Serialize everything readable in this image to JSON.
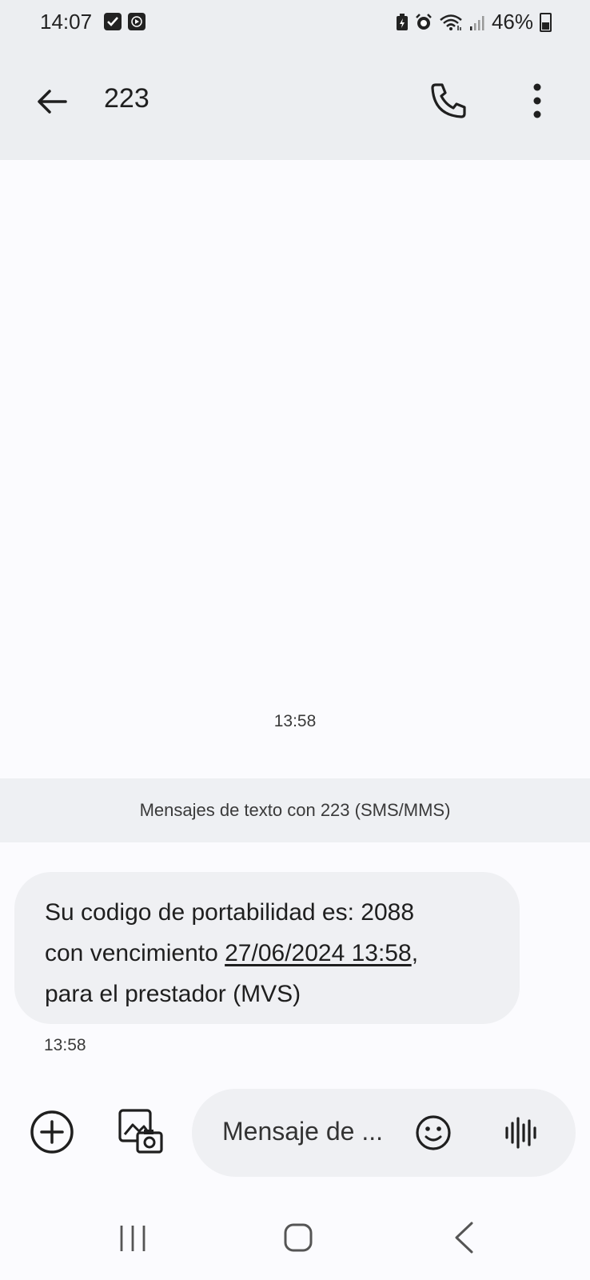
{
  "status_bar": {
    "time": "14:07",
    "battery": "46%",
    "icons": [
      "checkbox-notification-icon",
      "media-notification-icon",
      "battery-saver-icon",
      "alarm-icon",
      "wifi-icon",
      "signal-icon",
      "battery-icon"
    ]
  },
  "header": {
    "title": "223",
    "icons": [
      "back-arrow-icon",
      "phone-icon",
      "more-vert-icon"
    ]
  },
  "conversation": {
    "day_timestamp": "13:58",
    "banner": "Mensajes de texto con 223 (SMS/MMS)",
    "message": {
      "line1": "Su codigo de portabilidad es: 2088",
      "line2_prefix": "con vencimiento ",
      "line2_link": "27/06/2024 13:58",
      "line2_suffix": ",",
      "line3": "para el prestador (MVS)",
      "time": "13:58"
    }
  },
  "compose": {
    "placeholder": "Mensaje de ...",
    "icons": [
      "add-circle-icon",
      "gallery-camera-icon",
      "emoji-icon",
      "voice-waveform-icon"
    ]
  },
  "navigation": {
    "icons": [
      "recents-icon",
      "home-icon",
      "back-chevron-icon"
    ]
  },
  "colors": {
    "header_bg": "#eceef1",
    "page_bg": "#fbfbfe",
    "bubble_bg": "#eff0f3",
    "text": "#1f1f1f"
  }
}
